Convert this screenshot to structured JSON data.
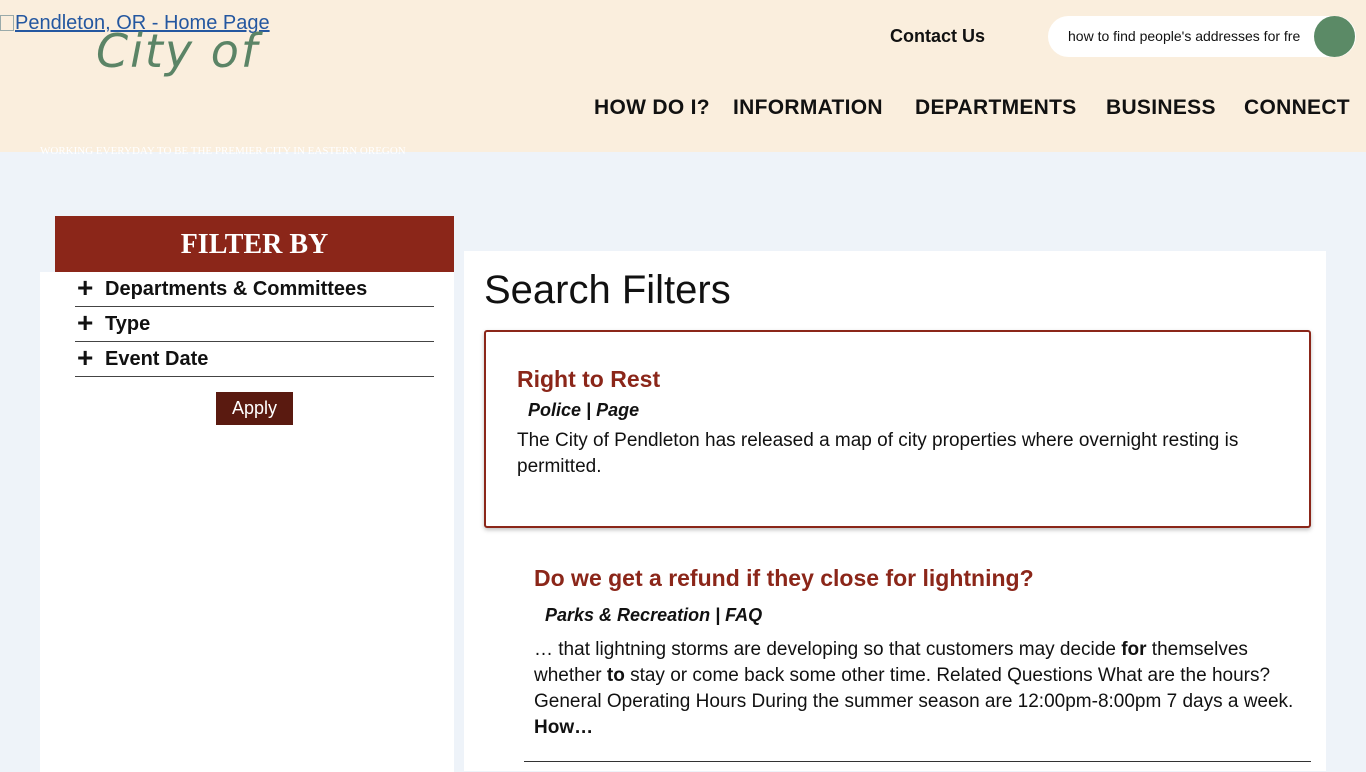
{
  "header": {
    "logo_alt": "Pendleton, OR - Home Page",
    "logo_text": "City of",
    "tagline": "WORKING EVERYDAY TO BE THE PREMIER CITY IN EASTERN OREGON",
    "contact": "Contact Us",
    "search_value": "how to find people's addresses for free",
    "nav": [
      "HOW DO I?",
      "INFORMATION",
      "DEPARTMENTS",
      "BUSINESS",
      "CONNECT"
    ]
  },
  "sidebar": {
    "title": "FILTER BY",
    "filters": [
      "Departments & Committees",
      "Type",
      "Event Date"
    ],
    "apply": "Apply"
  },
  "main": {
    "title": "Search Filters",
    "results": [
      {
        "title": "Right to Rest",
        "meta": "Police | Page",
        "desc": "The City of Pendleton has released a map of city properties where overnight resting is permitted."
      },
      {
        "title": "Do we get a refund if they close for lightning?",
        "meta": "Parks & Recreation | FAQ",
        "desc_parts": [
          "… that lightning storms are developing so that customers may decide ",
          "for",
          " themselves whether ",
          "to",
          " stay or come back some other time. Related Questions What are the hours? General Operating Hours During the summer season are 12:00pm-8:00pm 7 days a week.  ",
          "How…"
        ]
      }
    ]
  },
  "colors": {
    "header_bg": "#faeedd",
    "accent": "#8b2619",
    "search_button": "#5b8a66",
    "page_bg": "#eef3f9"
  }
}
